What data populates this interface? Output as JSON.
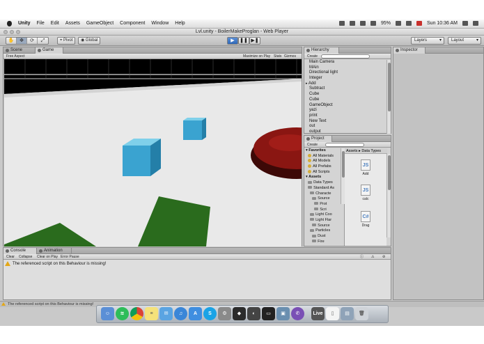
{
  "menubar": {
    "app_name": "Unity",
    "menus": [
      "File",
      "Edit",
      "Assets",
      "GameObject",
      "Component",
      "Window",
      "Help"
    ],
    "battery": "95%",
    "clock": "Sun 10:36 AM"
  },
  "window": {
    "title": "Lvl.unity - BoilerMakeProglan - Web Player"
  },
  "toolbar": {
    "pivot_label": "Pivot",
    "global_label": "Global",
    "play_icons": [
      "▶",
      "❚❚",
      "▶❚"
    ],
    "tools": [
      "✋",
      "✥",
      "⟳",
      "⤢"
    ],
    "layers_label": "Layers",
    "layout_label": "Layout"
  },
  "game_panel": {
    "tabs": [
      "Scene",
      "Game"
    ],
    "aspect_label": "Free Aspect",
    "options": [
      "Maximize on Play",
      "Stats",
      "Gizmos"
    ]
  },
  "hierarchy": {
    "tab": "Hierarchy",
    "create_label": "Create",
    "items": [
      "Main Camera",
      "MAin",
      "Directional light",
      "Integer",
      "Add",
      "Subtract",
      "Cube",
      "Cube",
      "GameObject",
      "yazi",
      "print",
      "New Text",
      "out",
      "output"
    ]
  },
  "project": {
    "tab": "Project",
    "create_label": "Create",
    "favorites_label": "Favorites",
    "favorites": [
      "All Materials",
      "All Models",
      "All Prefabs",
      "All Scripts"
    ],
    "assets_label": "Assets",
    "tree": [
      "Data Types",
      "Standard As",
      "Characte",
      "Source",
      "Prot",
      "Scri",
      "Light Coo",
      "Light Flar",
      "Source",
      "Particles",
      "Dust",
      "Fire"
    ],
    "breadcrumb": "Assets ▸ Data Types",
    "files": [
      {
        "icon": "JS",
        "label": "Add"
      },
      {
        "icon": "JS",
        "label": "calc"
      },
      {
        "icon": "C#",
        "label": "Drag"
      }
    ]
  },
  "inspector": {
    "tab": "Inspector"
  },
  "console": {
    "tabs": [
      "Console",
      "Animation"
    ],
    "buttons": [
      "Clear",
      "Collapse",
      "Clear on Play",
      "Error Pause"
    ],
    "message": "The referenced script on this Behaviour is missing!"
  },
  "statusbar": {
    "message": "The referenced script on this Behaviour is missing!"
  },
  "dock": {
    "items": [
      "finder-icon",
      "spotify-icon",
      "chrome-icon",
      "notes-icon",
      "mail-icon",
      "itunes-icon",
      "appstore-icon",
      "skype-icon",
      "settings-icon",
      "unity-icon",
      "photos-icon",
      "terminal-icon",
      "preview-icon",
      "viber-icon",
      "live-icon",
      "document-icon",
      "folder-icon",
      "trash-icon"
    ],
    "live_label": "Live"
  },
  "colors": {
    "cube": "#3aa3d0",
    "floor": "#e8e8e8",
    "grass": "#2a6b1d",
    "lava": "#8a1612",
    "accent": "#2f68b8"
  }
}
